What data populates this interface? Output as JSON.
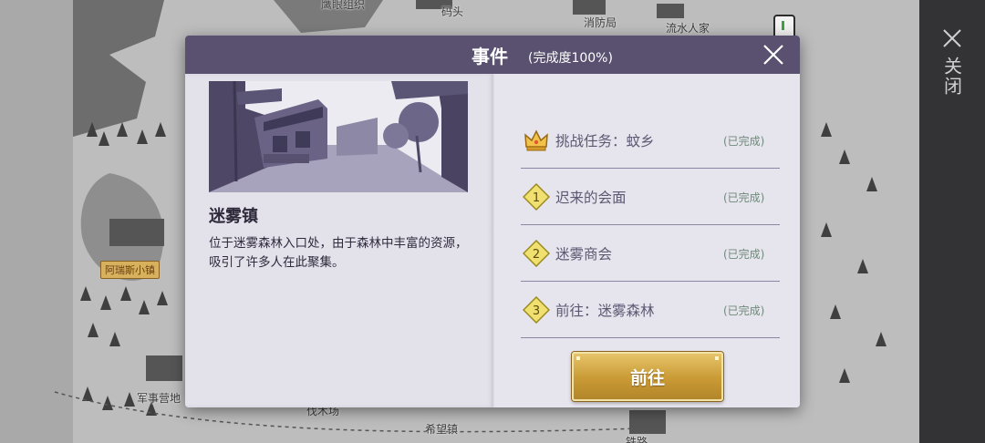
{
  "map": {
    "labels": {
      "eagle": "鹰眼组织",
      "dock": "码头",
      "fire": "消防局",
      "family": "流水人家",
      "arius": "阿瑞斯小镇",
      "camp": "军事营地",
      "lumber": "伐木场",
      "hope": "希望镇",
      "rail": "铁路"
    }
  },
  "side": {
    "close_label": "关闭",
    "close_icon": "close-icon"
  },
  "dialog": {
    "title": "事件",
    "progress": "(完成度100%)",
    "close_icon": "close-icon",
    "location": {
      "name": "迷雾镇",
      "description": "位于迷雾森林入口处，由于森林中丰富的资源，吸引了许多人在此聚集。"
    },
    "tasks": [
      {
        "icon": "crown-icon",
        "label": "挑战任务：蚊乡",
        "status": "(已完成)"
      },
      {
        "icon": "diamond-1-icon",
        "number": "1",
        "label": "迟来的会面",
        "status": "(已完成)"
      },
      {
        "icon": "diamond-2-icon",
        "number": "2",
        "label": "迷雾商会",
        "status": "(已完成)"
      },
      {
        "icon": "diamond-3-icon",
        "number": "3",
        "label": "前往：迷雾森林",
        "status": "(已完成)"
      }
    ],
    "go_button": "前往"
  },
  "colors": {
    "header": "#5a5171",
    "panel": "#e3e1ea",
    "button_gold": "#c99a34",
    "diamond": "#f0e070"
  }
}
